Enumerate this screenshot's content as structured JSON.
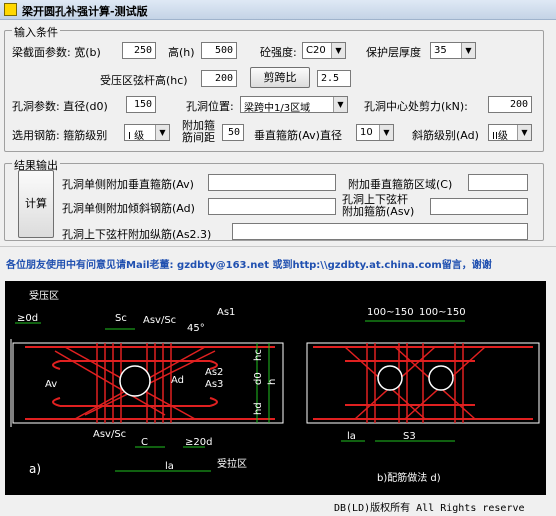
{
  "window": {
    "title": "梁开圆孔补强计算-测试版"
  },
  "input": {
    "group_title": "输入条件",
    "beam_section_label": "梁截面参数: 宽(b)",
    "width": "250",
    "height_label": "高(h)",
    "height": "500",
    "concrete_label": "砼强度:",
    "concrete": "C20",
    "cover_label": "保护层厚度",
    "cover": "35",
    "chord_label": "受压区弦杆高(hc)",
    "chord_height": "200",
    "span_ratio_button": "剪跨比",
    "span_ratio": "2.5",
    "hole_label": "孔洞参数: 直径(d0)",
    "hole_diameter": "150",
    "hole_pos_label": "孔洞位置:",
    "hole_position": "梁跨中1/3区域",
    "shear_label": "孔洞中心处剪力(kN):",
    "shear": "200",
    "rebar_label": "选用钢筋: 箍筋级别",
    "stirrup_grade": "I 级",
    "add_stirrup_label_1": "附加箍",
    "add_stirrup_label_2": "筋间距",
    "add_stirrup_spacing": "50",
    "vert_stirrup_label": "垂直箍筋(Av)直径",
    "vert_stirrup_dia": "10",
    "diag_label": "斜筋级别(Ad)",
    "diag_grade": "II级"
  },
  "output": {
    "group_title": "结果输出",
    "calc_button": "计算",
    "av_label": "孔洞单侧附加垂直箍筋(Av)",
    "av_value": "",
    "region_label": "附加垂直箍筋区域(C)",
    "region_value": "",
    "ad_label": "孔洞单侧附加倾斜钢筋(Ad)",
    "ad_value": "",
    "asv_label_1": "孔洞上下弦杆",
    "asv_label_2": "附加箍筋(Asv)",
    "asv_value": "",
    "as23_label": "孔洞上下弦杆附加纵筋(As2.3)",
    "as23_value": ""
  },
  "notice": "各位朋友使用中有问意见请Mail老董: gzdbty@163.net 或到http:\\\\gzdbty.at.china.com留言，谢谢",
  "drawing": {
    "label_zone": "受压区",
    "label_50d": "≥0d",
    "label_sc": "Sc",
    "label_asv_sc": "Asv/Sc",
    "label_45": "45°",
    "label_as1": "As1",
    "label_as2": "As2",
    "label_as3": "As3",
    "label_av": "Av",
    "label_ad": "Ad",
    "label_hc": "hc",
    "label_d0": "d0",
    "label_h": "h",
    "label_hd": "hd",
    "label_asv_sc_b": "Asv/Sc",
    "label_c": "C",
    "label_20d": "≥20d",
    "label_la": "la",
    "label_zone2": "受拉区",
    "label_a": "a)",
    "label_100_1": "100~150",
    "label_100_2": "100~150",
    "label_la2": "la",
    "label_s3": "S3",
    "label_b": "b)配筋做法 d)"
  },
  "footer": "DB(LD)版权所有 All Rights reserve"
}
